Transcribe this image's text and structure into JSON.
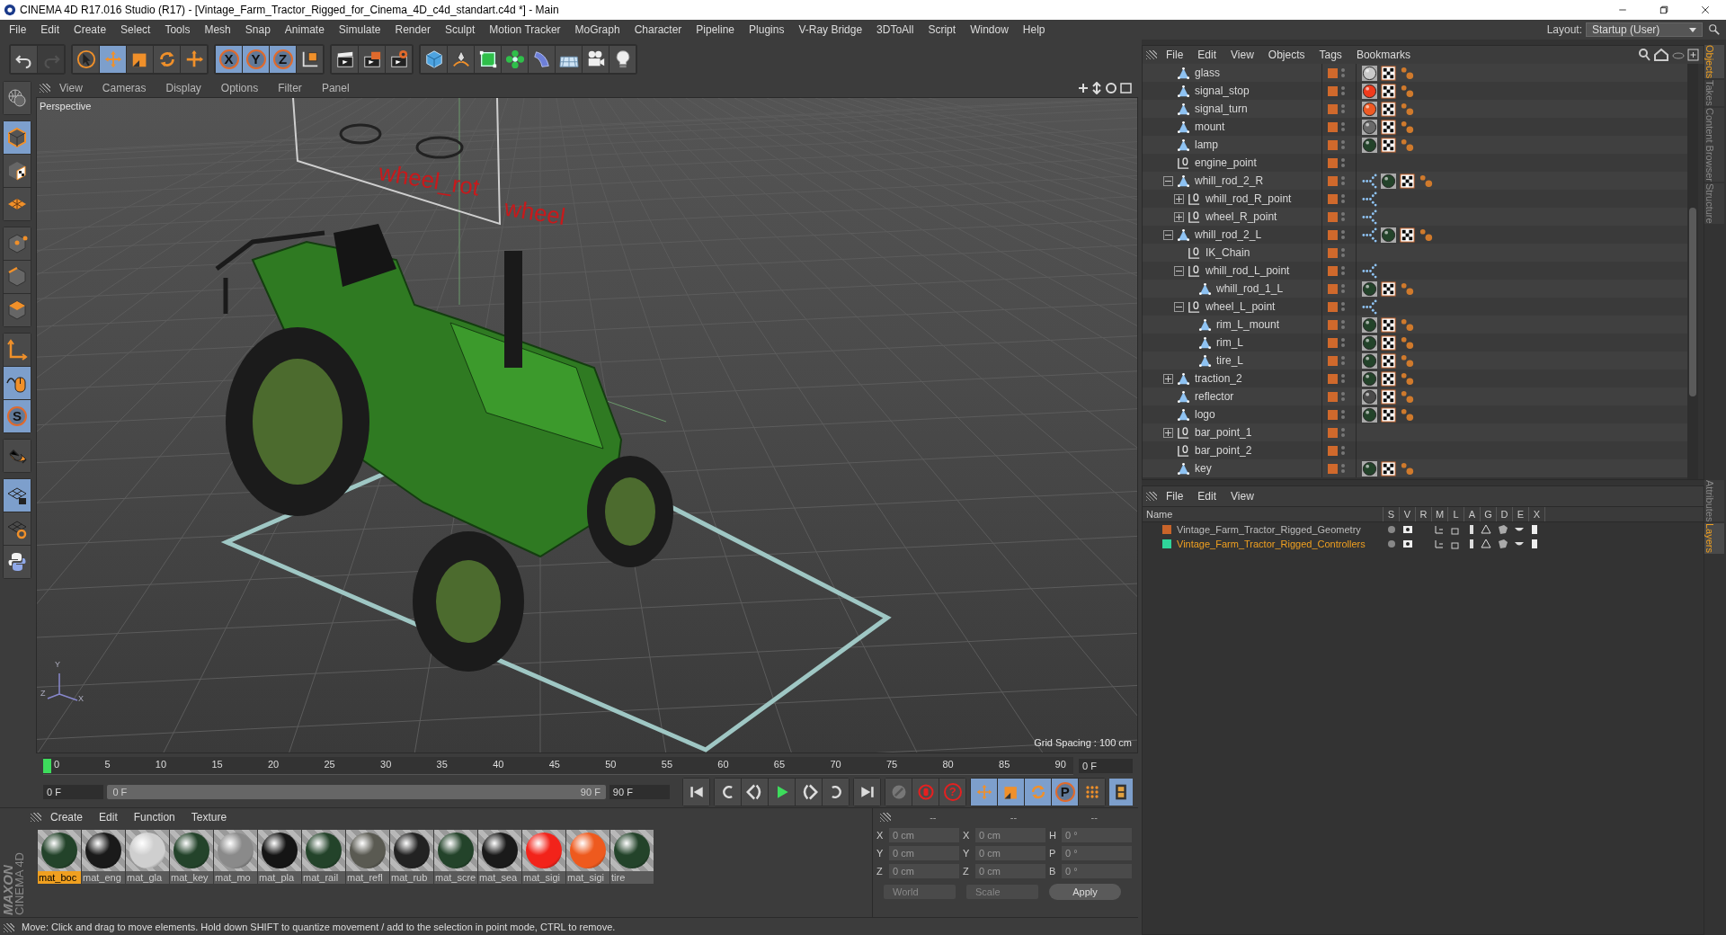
{
  "window": {
    "title": "CINEMA 4D R17.016 Studio (R17) - [Vintage_Farm_Tractor_Rigged_for_Cinema_4D_c4d_standart.c4d *] - Main"
  },
  "menu": [
    "File",
    "Edit",
    "Create",
    "Select",
    "Tools",
    "Mesh",
    "Snap",
    "Animate",
    "Simulate",
    "Render",
    "Sculpt",
    "Motion Tracker",
    "MoGraph",
    "Character",
    "Pipeline",
    "Plugins",
    "V-Ray Bridge",
    "3DToAll",
    "Script",
    "Window",
    "Help"
  ],
  "layout": {
    "label": "Layout:",
    "value": "Startup (User)"
  },
  "toolbar": [
    [
      {
        "kind": "undo"
      },
      {
        "kind": "redo",
        "disabled": true
      }
    ],
    [
      {
        "kind": "select",
        "selected": false
      },
      {
        "kind": "move",
        "selected": true
      },
      {
        "kind": "scale",
        "selected": false
      },
      {
        "kind": "rotate",
        "selected": false
      },
      {
        "kind": "recent",
        "selected": false
      }
    ],
    [
      {
        "kind": "axis",
        "label": "X",
        "selected": true
      },
      {
        "kind": "axis",
        "label": "Y",
        "selected": true
      },
      {
        "kind": "axis",
        "label": "Z",
        "selected": true
      },
      {
        "kind": "coords",
        "selected": false
      }
    ],
    [
      {
        "kind": "render-view",
        "selected": false
      },
      {
        "kind": "render-viewer",
        "selected": false
      },
      {
        "kind": "render-settings",
        "selected": false
      }
    ],
    [
      {
        "kind": "cube",
        "selected": false
      },
      {
        "kind": "pen",
        "selected": false
      },
      {
        "kind": "subdivision",
        "selected": false
      },
      {
        "kind": "cloner",
        "selected": false
      },
      {
        "kind": "deformer",
        "selected": false
      },
      {
        "kind": "floor",
        "selected": false
      },
      {
        "kind": "camera",
        "selected": false
      },
      {
        "kind": "light",
        "selected": false
      }
    ]
  ],
  "left_toolbar": [
    [
      {
        "kind": "globe",
        "selected": false
      }
    ],
    [
      {
        "kind": "object-mode",
        "selected": true
      },
      {
        "kind": "texture-mode",
        "selected": false
      },
      {
        "kind": "workplane",
        "selected": false
      }
    ],
    [
      {
        "kind": "points",
        "selected": false
      },
      {
        "kind": "edges",
        "selected": false
      },
      {
        "kind": "polygons",
        "selected": false
      }
    ],
    [
      {
        "kind": "axis-mode",
        "selected": false
      },
      {
        "kind": "tweak",
        "selected": true
      },
      {
        "kind": "solo",
        "label": "S",
        "selected": true
      }
    ],
    [
      {
        "kind": "magnet",
        "selected": false
      }
    ],
    [
      {
        "kind": "grid-lock",
        "selected": true
      },
      {
        "kind": "grid-refresh",
        "selected": false
      },
      {
        "kind": "python",
        "selected": false
      }
    ]
  ],
  "viewport": {
    "menu": [
      "View",
      "Cameras",
      "Display",
      "Options",
      "Filter",
      "Panel"
    ],
    "camera": "Perspective",
    "grid_spacing": "Grid Spacing : 100 cm",
    "scene_labels": [
      "wheel_rot",
      "wheel"
    ],
    "axis_labels": [
      "Y",
      "Z",
      "X"
    ]
  },
  "objects": {
    "menu": [
      "File",
      "Edit",
      "View",
      "Objects",
      "Tags",
      "Bookmarks"
    ],
    "items": [
      {
        "name": "glass",
        "kind": "polygon",
        "tags": [
          {
            "kind": "material",
            "color": "#c9c9c9"
          },
          {
            "kind": "uvw"
          },
          {
            "kind": "weight"
          }
        ]
      },
      {
        "name": "signal_stop",
        "kind": "polygon",
        "tags": [
          {
            "kind": "material",
            "color": "#f03a1c"
          },
          {
            "kind": "uvw"
          },
          {
            "kind": "weight"
          }
        ]
      },
      {
        "name": "signal_turn",
        "kind": "polygon",
        "tags": [
          {
            "kind": "material",
            "color": "#ef5a24"
          },
          {
            "kind": "uvw"
          },
          {
            "kind": "weight"
          }
        ]
      },
      {
        "name": "mount",
        "kind": "polygon",
        "tags": [
          {
            "kind": "material",
            "color": "#6a6a6a"
          },
          {
            "kind": "uvw"
          },
          {
            "kind": "weight"
          }
        ]
      },
      {
        "name": "lamp",
        "kind": "polygon",
        "tags": [
          {
            "kind": "material",
            "color": "#23432a"
          },
          {
            "kind": "uvw"
          },
          {
            "kind": "weight"
          }
        ]
      },
      {
        "name": "engine_point",
        "kind": "null"
      },
      {
        "name": "whill_rod_2_R",
        "kind": "polygon",
        "expanded": true,
        "tags": [
          {
            "kind": "ik"
          },
          {
            "kind": "material",
            "color": "#23432a"
          },
          {
            "kind": "uvw"
          },
          {
            "kind": "weight"
          }
        ],
        "children": [
          {
            "name": "whill_rod_R_point",
            "kind": "null",
            "expanded": false,
            "tags": [
              {
                "kind": "ik"
              }
            ]
          },
          {
            "name": "wheel_R_point",
            "kind": "null",
            "expanded": false,
            "tags": [
              {
                "kind": "ik"
              }
            ]
          }
        ]
      },
      {
        "name": "whill_rod_2_L",
        "kind": "polygon",
        "expanded": true,
        "tags": [
          {
            "kind": "ik"
          },
          {
            "kind": "material",
            "color": "#23432a"
          },
          {
            "kind": "uvw"
          },
          {
            "kind": "weight"
          }
        ],
        "children": [
          {
            "name": "IK_Chain",
            "kind": "null"
          },
          {
            "name": "whill_rod_L_point",
            "kind": "null",
            "expanded": true,
            "tags": [
              {
                "kind": "ik"
              }
            ],
            "children": [
              {
                "name": "whill_rod_1_L",
                "kind": "polygon",
                "tags": [
                  {
                    "kind": "material",
                    "color": "#23432a"
                  },
                  {
                    "kind": "uvw"
                  },
                  {
                    "kind": "weight"
                  }
                ]
              }
            ]
          },
          {
            "name": "wheel_L_point",
            "kind": "null",
            "expanded": true,
            "tags": [
              {
                "kind": "ik"
              }
            ],
            "children": [
              {
                "name": "rim_L_mount",
                "kind": "polygon",
                "tags": [
                  {
                    "kind": "material",
                    "color": "#23432a"
                  },
                  {
                    "kind": "uvw"
                  },
                  {
                    "kind": "weight"
                  }
                ]
              },
              {
                "name": "rim_L",
                "kind": "polygon",
                "tags": [
                  {
                    "kind": "material",
                    "color": "#23432a"
                  },
                  {
                    "kind": "uvw"
                  },
                  {
                    "kind": "weight"
                  }
                ]
              },
              {
                "name": "tire_L",
                "kind": "polygon",
                "tags": [
                  {
                    "kind": "material",
                    "color": "#23432a"
                  },
                  {
                    "kind": "uvw"
                  },
                  {
                    "kind": "weight"
                  }
                ]
              }
            ]
          }
        ]
      },
      {
        "name": "traction_2",
        "kind": "polygon",
        "expanded": false,
        "tags": [
          {
            "kind": "material",
            "color": "#23432a"
          },
          {
            "kind": "uvw"
          },
          {
            "kind": "weight"
          }
        ]
      },
      {
        "name": "reflector",
        "kind": "polygon",
        "tags": [
          {
            "kind": "material",
            "color": "#4a4a4a"
          },
          {
            "kind": "uvw"
          },
          {
            "kind": "weight"
          }
        ]
      },
      {
        "name": "logo",
        "kind": "polygon",
        "tags": [
          {
            "kind": "material",
            "color": "#23432a"
          },
          {
            "kind": "uvw"
          },
          {
            "kind": "weight"
          }
        ]
      },
      {
        "name": "bar_point_1",
        "kind": "null",
        "expanded": false
      },
      {
        "name": "bar_point_2",
        "kind": "null"
      },
      {
        "name": "key",
        "kind": "polygon",
        "tags": [
          {
            "kind": "material",
            "color": "#23432a"
          },
          {
            "kind": "uvw"
          },
          {
            "kind": "weight"
          }
        ]
      }
    ]
  },
  "side_tabs_top": [
    {
      "label": "Objects",
      "selected": true
    },
    {
      "label": "Takes",
      "selected": false
    },
    {
      "label": "Content Browser",
      "selected": false
    },
    {
      "label": "Structure",
      "selected": false
    }
  ],
  "side_tabs_bottom": [
    {
      "label": "Attributes",
      "selected": false
    },
    {
      "label": "Layers",
      "selected": true
    }
  ],
  "layers": {
    "menu": [
      "File",
      "Edit",
      "View"
    ],
    "columns": [
      "Name",
      "S",
      "V",
      "R",
      "M",
      "L",
      "A",
      "G",
      "D",
      "E",
      "X"
    ],
    "rows": [
      {
        "name": "Vintage_Farm_Tractor_Rigged_Geometry",
        "color": "#c8642a",
        "selected": false
      },
      {
        "name": "Vintage_Farm_Tractor_Rigged_Controllers",
        "color": "#2fd49a",
        "selected": true
      }
    ]
  },
  "timeline": {
    "ticks": [
      "0",
      "5",
      "10",
      "15",
      "20",
      "25",
      "30",
      "35",
      "40",
      "45",
      "50",
      "55",
      "60",
      "65",
      "70",
      "75",
      "80",
      "85",
      "90"
    ],
    "current": "0 F",
    "start": "0 F",
    "range_start": "0 F",
    "range_end": "90 F",
    "end": "90 F",
    "controls": [
      {
        "kind": "go-start"
      },
      {
        "kind": "prev-key"
      },
      {
        "kind": "prev-frame"
      },
      {
        "kind": "play"
      },
      {
        "kind": "next-frame"
      },
      {
        "kind": "next-key"
      },
      {
        "kind": "go-end"
      }
    ],
    "record": [
      {
        "kind": "motion"
      },
      {
        "kind": "record"
      },
      {
        "kind": "autokey",
        "label": "?"
      }
    ],
    "keys": [
      {
        "kind": "move",
        "selected": true
      },
      {
        "kind": "scale",
        "selected": true
      },
      {
        "kind": "rotate",
        "selected": true
      },
      {
        "kind": "param",
        "label": "P",
        "selected": true
      },
      {
        "kind": "pla",
        "selected": false
      }
    ]
  },
  "materials": {
    "logo": [
      "MAXON",
      "CINEMA 4D"
    ],
    "menu": [
      "Create",
      "Edit",
      "Function",
      "Texture"
    ],
    "items": [
      {
        "name": "mat_boc",
        "color": "#23432a",
        "selected": true
      },
      {
        "name": "mat_eng",
        "color": "#1a1a1a",
        "selected": false
      },
      {
        "name": "mat_gla",
        "color": "#cfcfcf",
        "selected": false
      },
      {
        "name": "mat_key",
        "color": "#23432a",
        "selected": false
      },
      {
        "name": "mat_mo",
        "color": "#8a8a8a",
        "selected": false
      },
      {
        "name": "mat_pla",
        "color": "#151515",
        "selected": false
      },
      {
        "name": "mat_rail",
        "color": "#23432a",
        "selected": false
      },
      {
        "name": "mat_refl",
        "color": "#5a5a52",
        "selected": false
      },
      {
        "name": "mat_rub",
        "color": "#222222",
        "selected": false
      },
      {
        "name": "mat_scre",
        "color": "#23432a",
        "selected": false
      },
      {
        "name": "mat_sea",
        "color": "#1a1a1a",
        "selected": false
      },
      {
        "name": "mat_sigi",
        "color": "#f2231a",
        "selected": false
      },
      {
        "name": "mat_sigi",
        "color": "#ee5a1e",
        "selected": false
      },
      {
        "name": "tire",
        "color": "#23432a",
        "selected": false
      }
    ]
  },
  "coordinates": {
    "headers": [
      "--",
      "--",
      "--"
    ],
    "rows": [
      [
        {
          "label": "X",
          "value": "0 cm"
        },
        {
          "label": "X",
          "value": "0 cm"
        },
        {
          "label": "H",
          "value": "0 °"
        }
      ],
      [
        {
          "label": "Y",
          "value": "0 cm"
        },
        {
          "label": "Y",
          "value": "0 cm"
        },
        {
          "label": "P",
          "value": "0 °"
        }
      ],
      [
        {
          "label": "Z",
          "value": "0 cm"
        },
        {
          "label": "Z",
          "value": "0 cm"
        },
        {
          "label": "B",
          "value": "0 °"
        }
      ]
    ],
    "space": "World",
    "mode": "Scale",
    "apply": "Apply"
  },
  "status_bar": "Move: Click and drag to move elements. Hold down SHIFT to quantize movement / add to the selection in point mode, CTRL to remove."
}
